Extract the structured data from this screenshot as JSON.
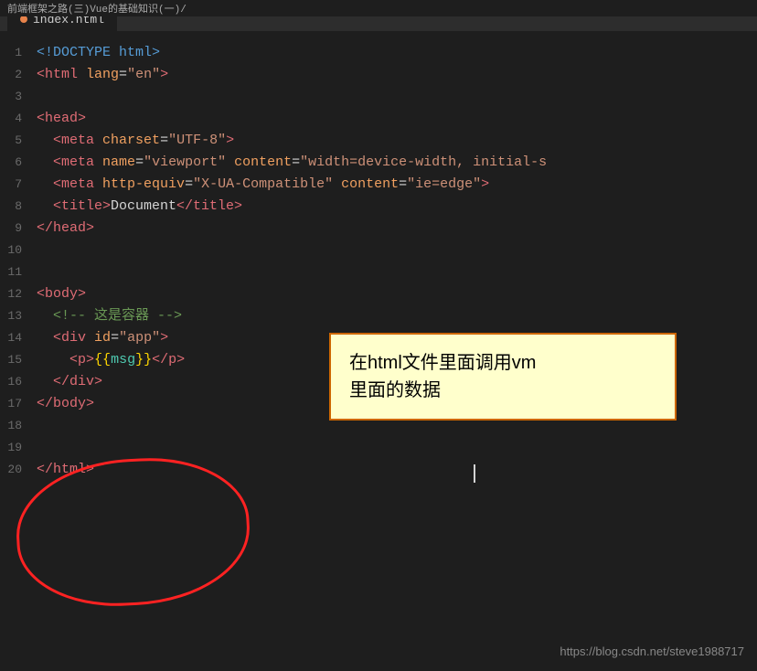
{
  "tabBar": {
    "breadcrumb": "前端框架之路(三)Vue的基础知识(一)/",
    "tab": {
      "label": "index.html",
      "modified": false
    }
  },
  "editor": {
    "lines": [
      {
        "num": 1,
        "tokens": [
          {
            "t": "doctype",
            "v": "<!DOCTYPE html>"
          }
        ]
      },
      {
        "num": 2,
        "tokens": [
          {
            "t": "tag",
            "v": "<html"
          },
          {
            "t": "space"
          },
          {
            "t": "attr-name",
            "v": "lang"
          },
          {
            "t": "equals",
            "v": "="
          },
          {
            "t": "attr-value",
            "v": "\"en\""
          },
          {
            "t": "tag",
            "v": ">"
          }
        ]
      },
      {
        "num": 3,
        "tokens": []
      },
      {
        "num": 4,
        "tokens": [
          {
            "t": "tag",
            "v": "<head>"
          }
        ]
      },
      {
        "num": 5,
        "tokens": [
          {
            "t": "indent",
            "v": "  "
          },
          {
            "t": "tag",
            "v": "<meta"
          },
          {
            "t": "space"
          },
          {
            "t": "attr-name",
            "v": "charset"
          },
          {
            "t": "equals",
            "v": "="
          },
          {
            "t": "attr-value",
            "v": "\"UTF-8\""
          },
          {
            "t": "tag",
            "v": ">"
          }
        ]
      },
      {
        "num": 6,
        "tokens": [
          {
            "t": "indent",
            "v": "  "
          },
          {
            "t": "tag",
            "v": "<meta"
          },
          {
            "t": "space"
          },
          {
            "t": "attr-name",
            "v": "name"
          },
          {
            "t": "equals",
            "v": "="
          },
          {
            "t": "attr-value",
            "v": "\"viewport\""
          },
          {
            "t": "space"
          },
          {
            "t": "attr-name",
            "v": "content"
          },
          {
            "t": "equals",
            "v": "="
          },
          {
            "t": "attr-value",
            "v": "\"width=device-width, initial-s"
          }
        ]
      },
      {
        "num": 7,
        "tokens": [
          {
            "t": "indent",
            "v": "  "
          },
          {
            "t": "tag",
            "v": "<meta"
          },
          {
            "t": "space"
          },
          {
            "t": "attr-name",
            "v": "http-equiv"
          },
          {
            "t": "equals",
            "v": "="
          },
          {
            "t": "attr-value",
            "v": "\"X-UA-Compatible\""
          },
          {
            "t": "space"
          },
          {
            "t": "attr-name",
            "v": "content"
          },
          {
            "t": "equals",
            "v": "="
          },
          {
            "t": "attr-value",
            "v": "\"ie=edge\""
          },
          {
            "t": "tag",
            "v": ">"
          }
        ]
      },
      {
        "num": 8,
        "tokens": [
          {
            "t": "indent",
            "v": "  "
          },
          {
            "t": "tag",
            "v": "<title>"
          },
          {
            "t": "text",
            "v": "Document"
          },
          {
            "t": "tag",
            "v": "</title>"
          }
        ]
      },
      {
        "num": 9,
        "tokens": [
          {
            "t": "tag",
            "v": "</head>"
          }
        ]
      },
      {
        "num": 10,
        "tokens": []
      },
      {
        "num": 11,
        "tokens": []
      },
      {
        "num": 12,
        "tokens": [
          {
            "t": "tag",
            "v": "<body>"
          }
        ]
      },
      {
        "num": 13,
        "tokens": [
          {
            "t": "indent",
            "v": "  "
          },
          {
            "t": "comment",
            "v": "<!-- 这是容器 -->"
          }
        ]
      },
      {
        "num": 14,
        "tokens": [
          {
            "t": "indent",
            "v": "  "
          },
          {
            "t": "tag",
            "v": "<div"
          },
          {
            "t": "space"
          },
          {
            "t": "attr-name",
            "v": "id"
          },
          {
            "t": "equals",
            "v": "="
          },
          {
            "t": "attr-value",
            "v": "\"app\""
          },
          {
            "t": "tag",
            "v": ">"
          }
        ]
      },
      {
        "num": 15,
        "tokens": [
          {
            "t": "indent",
            "v": "    "
          },
          {
            "t": "tag",
            "v": "<p>"
          },
          {
            "t": "mustache",
            "v": "{{msg}}"
          },
          {
            "t": "tag",
            "v": "</p>"
          }
        ]
      },
      {
        "num": 16,
        "tokens": [
          {
            "t": "indent",
            "v": "  "
          },
          {
            "t": "tag",
            "v": "</div>"
          }
        ]
      },
      {
        "num": 17,
        "tokens": [
          {
            "t": "tag",
            "v": "</body>"
          }
        ]
      },
      {
        "num": 18,
        "tokens": []
      },
      {
        "num": 19,
        "tokens": []
      },
      {
        "num": 20,
        "tokens": [
          {
            "t": "tag",
            "v": "</html>"
          }
        ]
      }
    ]
  },
  "tooltip": {
    "text": "在html文件里面调用vm\n里面的数据"
  },
  "watermark": {
    "text": "https://blog.csdn.net/steve1988717"
  }
}
